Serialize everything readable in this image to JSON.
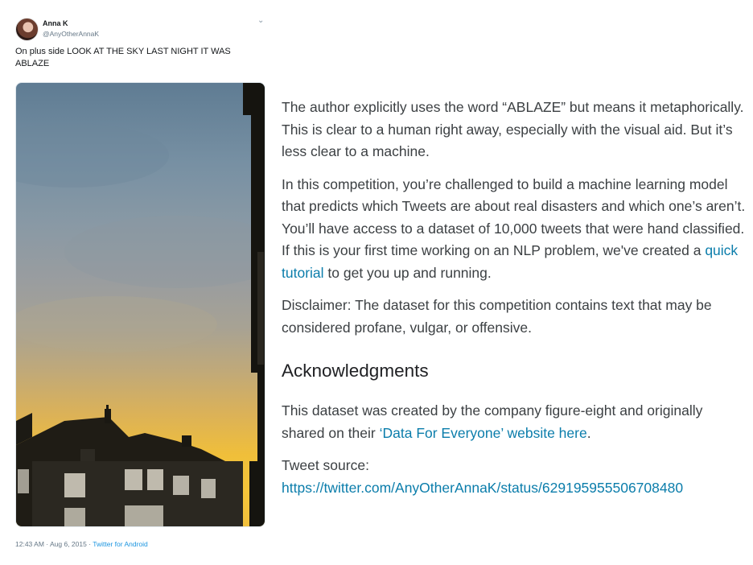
{
  "tweet": {
    "author_name": "Anna K",
    "author_handle": "@AnyOtherAnnaK",
    "caret_icon": "chevron-down-icon",
    "text": "On plus side LOOK AT THE SKY LAST NIGHT IT WAS ABLAZE",
    "time_date": "12:43 AM · Aug 6, 2015 · ",
    "source": "Twitter for Android"
  },
  "description": {
    "para1": "The author explicitly uses the word “ABLAZE” but means it metaphorically. This is clear to a human right away, especially with the visual aid. But it’s less clear to a machine.",
    "para2_before": "In this competition, you’re challenged to build a machine learning model that predicts which Tweets are about real disasters and which one’s aren’t. You’ll have access to a dataset of 10,000 tweets that were hand classified. If this is your first time working on an NLP problem, we've created a ",
    "para2_link": "quick tutorial",
    "para2_after": " to get you up and running.",
    "para3": "Disclaimer: The dataset for this competition contains text that may be considered profane, vulgar, or offensive.",
    "ack_heading": "Acknowledgments",
    "ack_before": "This dataset was created by the company figure-eight and originally shared on their ",
    "ack_link": "‘Data For Everyone’ website here",
    "ack_after": ".",
    "source_label": "Tweet source:",
    "source_link": "https://twitter.com/AnyOtherAnnaK/status/629195955506708480"
  }
}
